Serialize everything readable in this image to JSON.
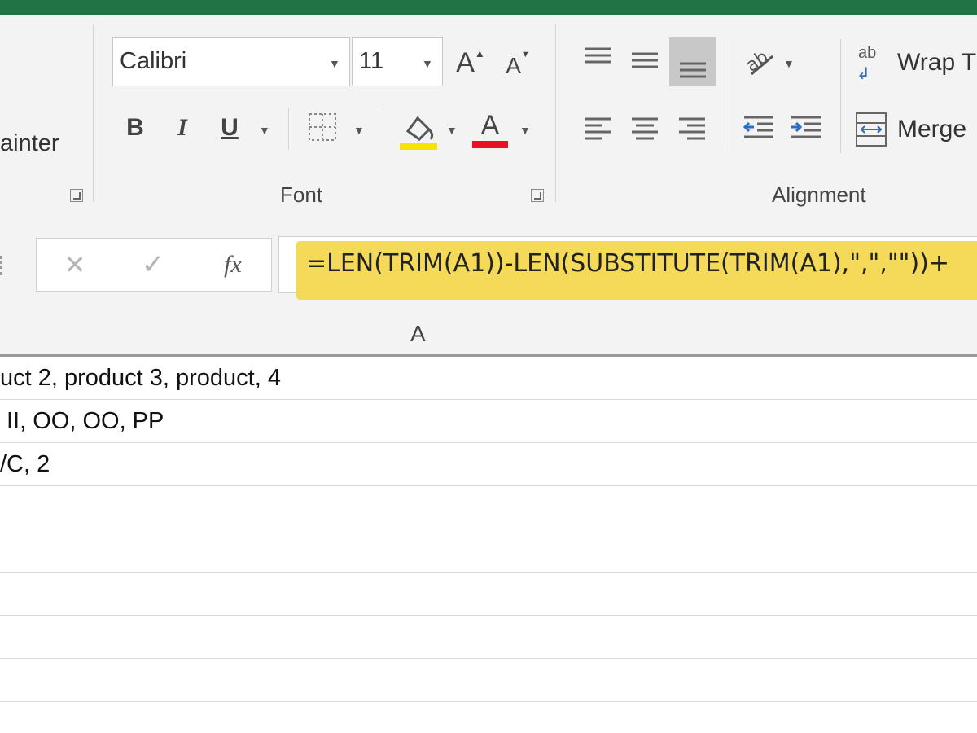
{
  "ribbon": {
    "clipboard": {
      "format_painter_label": "ainter"
    },
    "font": {
      "group_label": "Font",
      "font_name": "Calibri",
      "font_size": "11",
      "bold": "B",
      "italic": "I",
      "underline": "U",
      "grow_font": "A",
      "shrink_font": "A",
      "font_color_letter": "A",
      "fill_color": "#f5e400",
      "font_color": "#e81123"
    },
    "alignment": {
      "group_label": "Alignment",
      "wrap_text_label": "Wrap T",
      "merge_label": "Merge",
      "wrap_icon_text": "ab"
    }
  },
  "formula_bar": {
    "cancel": "✕",
    "enter": "✓",
    "fx": "fx",
    "formula": "=LEN(TRIM(A1))-LEN(SUBSTITUTE(TRIM(A1),\",\",\"\"))+",
    "highlight_color": "#f5da5a"
  },
  "sheet": {
    "column_header": "A",
    "rows": [
      "uct 2, product 3, product, 4",
      "II, OO, OO, PP",
      "/C, 2",
      "",
      "",
      "",
      "",
      "",
      ""
    ]
  }
}
